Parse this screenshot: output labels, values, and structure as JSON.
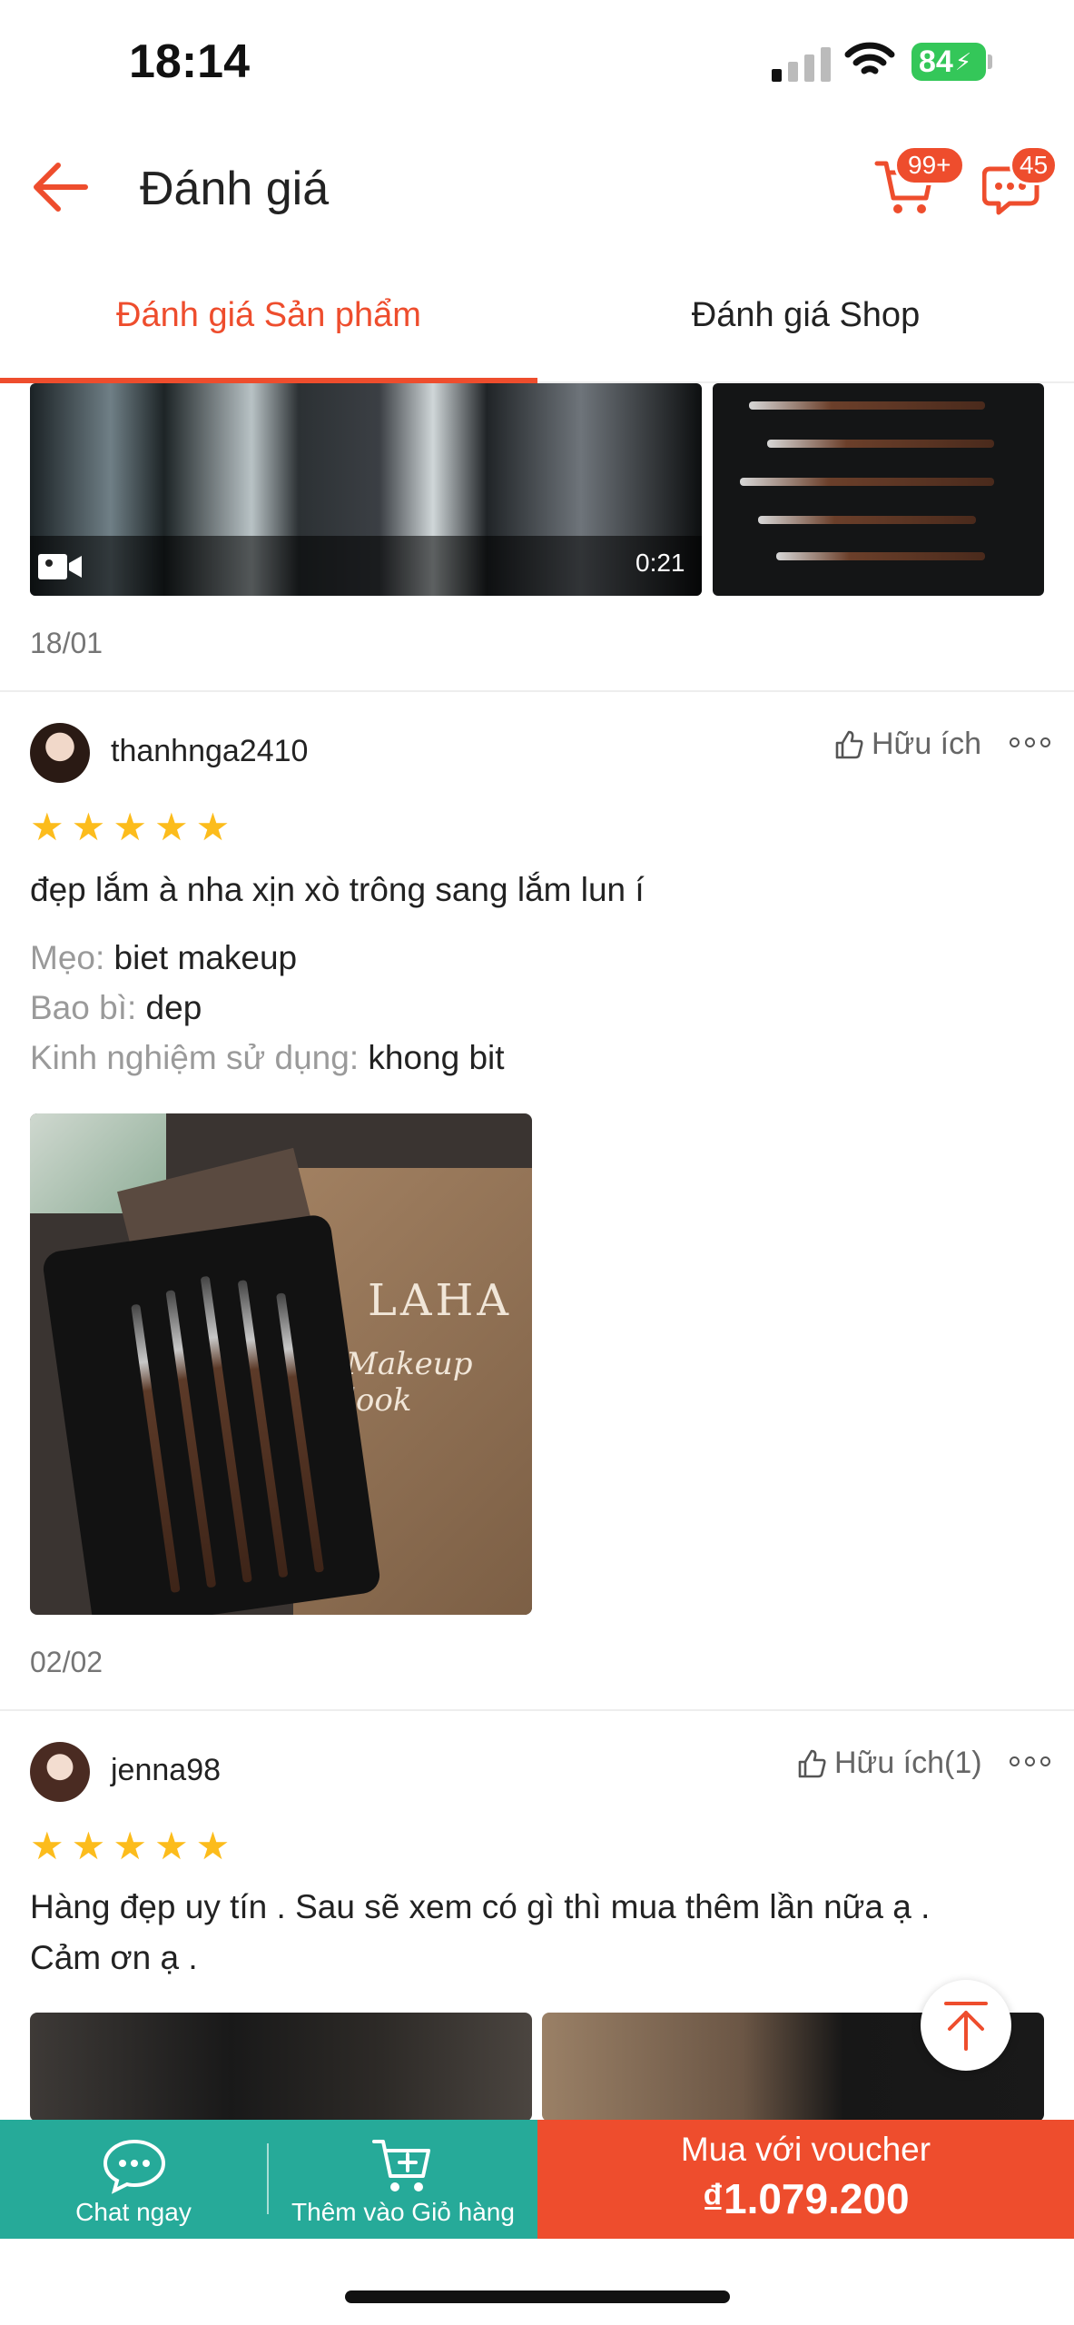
{
  "status_bar": {
    "time": "18:14",
    "battery": "84"
  },
  "header": {
    "title": "Đánh giá",
    "cart_badge": "99+",
    "chat_badge": "45"
  },
  "tabs": [
    {
      "label": "Đánh giá Sản phẩm",
      "active": true
    },
    {
      "label": "Đánh giá Shop",
      "active": false
    }
  ],
  "previous_review": {
    "video_duration": "0:21",
    "date": "18/01"
  },
  "reviews": [
    {
      "username": "thanhnga2410",
      "helpful": "Hữu ích",
      "rating": 5,
      "comment": "đẹp lắm à nha xịn xò trông sang lắm lun í",
      "meta": [
        {
          "key": "Mẹo:",
          "value": "biet makeup"
        },
        {
          "key": "Bao bì:",
          "value": "dep"
        },
        {
          "key": "Kinh nghiệm sử dụng:",
          "value": "khong bit"
        }
      ],
      "photo_text": {
        "brand": "LAHA",
        "subtitle": "Makeup look"
      },
      "date": "02/02"
    },
    {
      "username": "jenna98",
      "helpful": "Hữu ích(1)",
      "rating": 5,
      "comment_line1": "Hàng đẹp uy tín . Sau sẽ xem có gì thì mua thêm lần nữa ạ .",
      "comment_line2": "Cảm ơn ạ ."
    }
  ],
  "bottom_bar": {
    "chat_label": "Chat ngay",
    "add_cart_label": "Thêm vào Giỏ hàng",
    "buy_label": "Mua với voucher",
    "price": "₫1.079.200"
  },
  "colors": {
    "accent": "#ee4d2d",
    "teal": "#26aa99",
    "star": "#fcbc1c"
  }
}
